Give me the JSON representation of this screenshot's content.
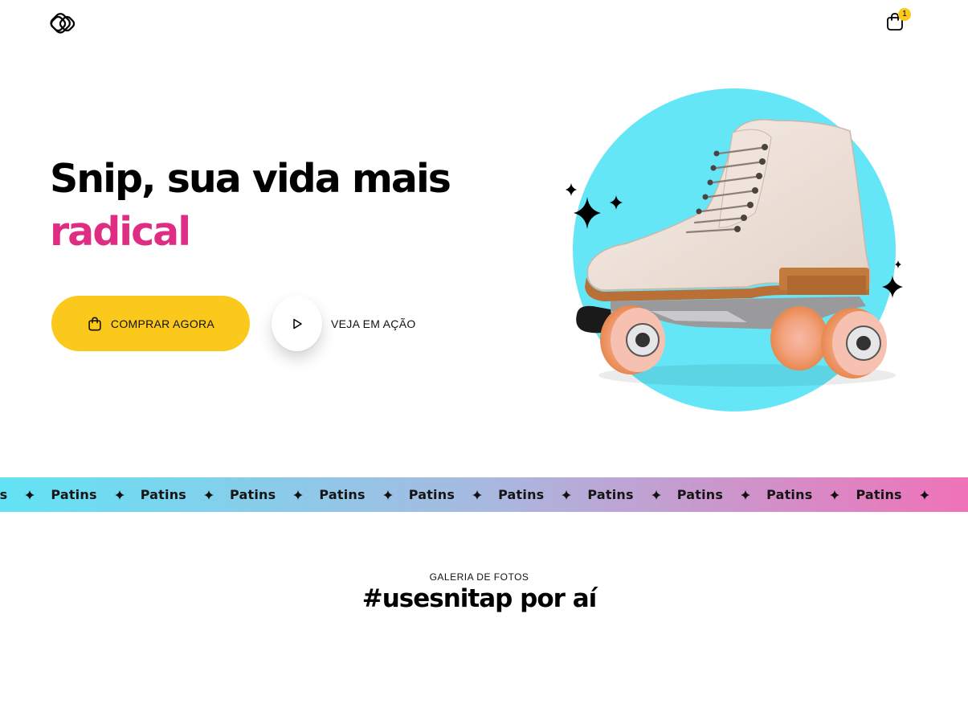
{
  "header": {
    "logo_icon": "snip-logo-icon",
    "cart_icon": "shopping-bag-icon",
    "cart_count": "1"
  },
  "hero": {
    "title_line1": "Snip, sua vida mais",
    "title_line2": "radical",
    "buy_button_label": "COMPRAR AGORA",
    "buy_button_icon": "shopping-bag-icon",
    "watch_button_label": "VEJA EM AÇÃO",
    "watch_button_icon": "play-icon",
    "product_image": "roller-skate-image"
  },
  "marquee": {
    "items": [
      "Patins",
      "Patins",
      "Patins",
      "Patins",
      "Patins",
      "Patins",
      "Patins",
      "Patins",
      "Patins",
      "Patins",
      "Patins"
    ],
    "separator_icon": "sparkle-icon"
  },
  "gallery": {
    "kicker": "GALERIA DE FOTOS",
    "title": "#usesnitap por aí"
  },
  "colors": {
    "accent_pink": "#df2d84",
    "accent_yellow": "#fbc91b",
    "circle_cyan": "#65e6f7",
    "marquee_gradient_start": "#62e3f5",
    "marquee_gradient_end": "#f072b8"
  }
}
